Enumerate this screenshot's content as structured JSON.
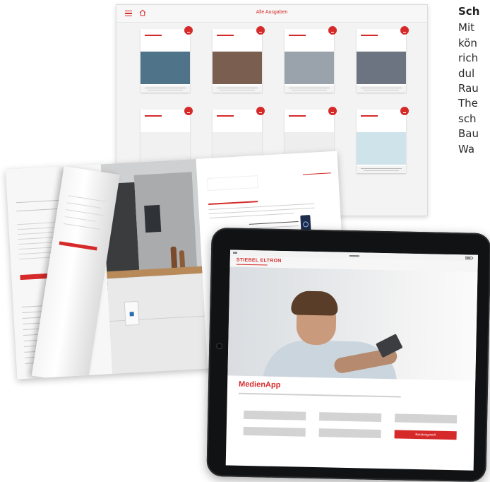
{
  "side_text": {
    "heading": "Sch",
    "lines": [
      "Mit",
      "kön",
      "rich",
      "dul",
      "Rau",
      "The",
      "sch",
      "Bau",
      "Wa"
    ]
  },
  "archive": {
    "title": "Alle Ausgaben",
    "covers": [
      {
        "photo": "#4f7388"
      },
      {
        "photo": "#7a5e4f"
      },
      {
        "photo": "#9aa3ab"
      },
      {
        "photo": "#6b7480"
      },
      {
        "photo": "#f1f1f1"
      },
      {
        "photo": "#f0f0f0"
      },
      {
        "photo": "#eeeeee"
      },
      {
        "photo": "#cfe3ea"
      }
    ]
  },
  "colors": {
    "accent": "#d62a2a",
    "button_gray": "#d3d3d3"
  },
  "app": {
    "brand": "STIEBEL ELTRON",
    "title": "MedienApp",
    "buttons": [
      "",
      "",
      "",
      "",
      "",
      "Beratungswelt"
    ]
  }
}
